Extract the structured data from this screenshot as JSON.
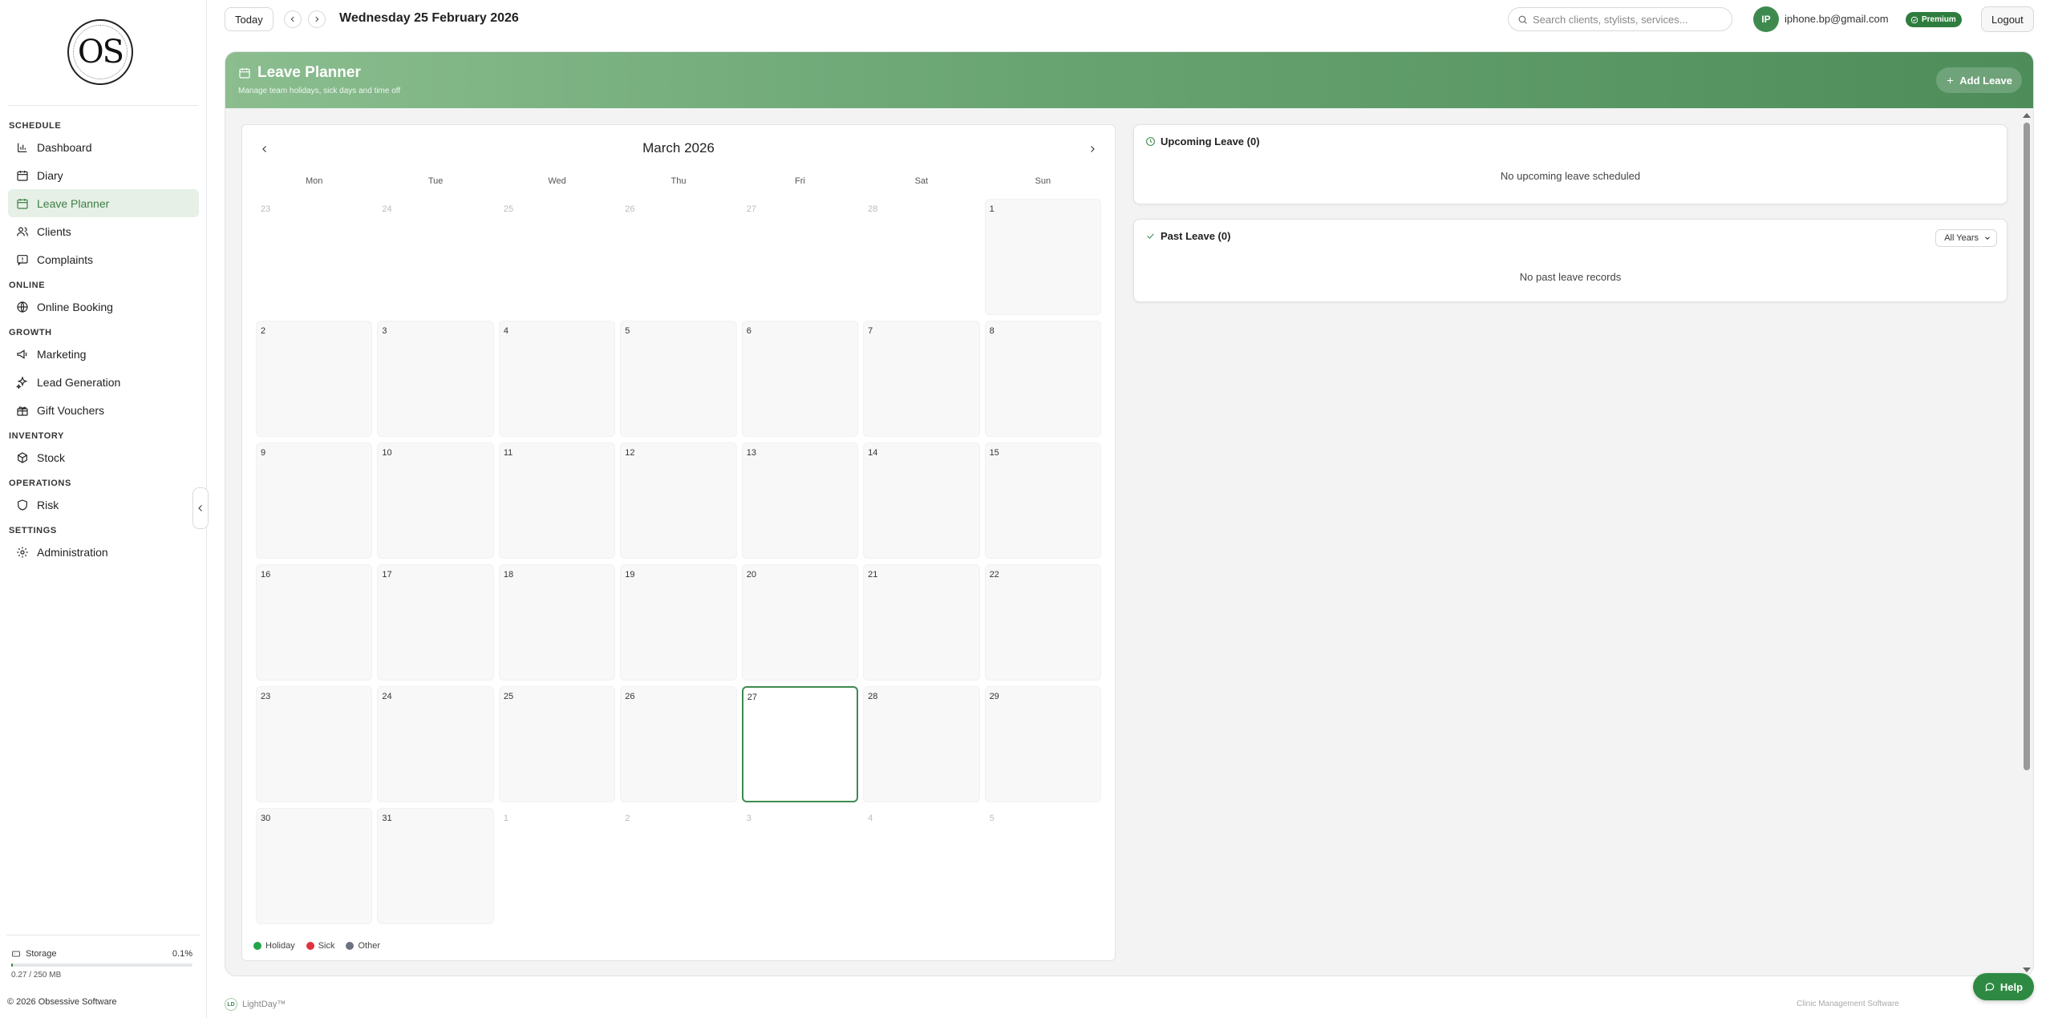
{
  "brand": {
    "logo_text": "OS"
  },
  "sidebar": {
    "sections": [
      {
        "title": "SCHEDULE",
        "items": [
          {
            "label": "Dashboard",
            "icon": "chart-icon",
            "active": false
          },
          {
            "label": "Diary",
            "icon": "calendar-icon",
            "active": false
          },
          {
            "label": "Leave Planner",
            "icon": "calendar-icon",
            "active": true
          },
          {
            "label": "Clients",
            "icon": "users-icon",
            "active": false
          },
          {
            "label": "Complaints",
            "icon": "message-icon",
            "active": false
          }
        ]
      },
      {
        "title": "ONLINE",
        "items": [
          {
            "label": "Online Booking",
            "icon": "globe-icon",
            "active": false
          }
        ]
      },
      {
        "title": "GROWTH",
        "items": [
          {
            "label": "Marketing",
            "icon": "megaphone-icon",
            "active": false
          },
          {
            "label": "Lead Generation",
            "icon": "sparkle-icon",
            "active": false
          },
          {
            "label": "Gift Vouchers",
            "icon": "gift-icon",
            "active": false
          }
        ]
      },
      {
        "title": "INVENTORY",
        "items": [
          {
            "label": "Stock",
            "icon": "package-icon",
            "active": false
          }
        ]
      },
      {
        "title": "OPERATIONS",
        "items": [
          {
            "label": "Risk",
            "icon": "shield-icon",
            "active": false
          }
        ]
      },
      {
        "title": "SETTINGS",
        "items": [
          {
            "label": "Administration",
            "icon": "gear-icon",
            "active": false
          }
        ]
      }
    ],
    "storage": {
      "label": "Storage",
      "percent": "0.1%",
      "fraction": 0.001,
      "detail": "0.27 / 250 MB"
    },
    "copyright": "© 2026 Obsessive Software"
  },
  "topbar": {
    "today_label": "Today",
    "current_date": "Wednesday 25 February 2026",
    "search_placeholder": "Search clients, stylists, services...",
    "avatar_initials": "IP",
    "user_email": "iphone.bp@gmail.com",
    "plan_badge": "Premium",
    "logout_label": "Logout"
  },
  "banner": {
    "title": "Leave Planner",
    "subtitle": "Manage team holidays, sick days and time off",
    "add_button": "Add Leave"
  },
  "calendar": {
    "month_label": "March 2026",
    "weekdays": [
      "Mon",
      "Tue",
      "Wed",
      "Thu",
      "Fri",
      "Sat",
      "Sun"
    ],
    "weeks": [
      [
        {
          "d": "23",
          "out": true
        },
        {
          "d": "24",
          "out": true
        },
        {
          "d": "25",
          "out": true
        },
        {
          "d": "26",
          "out": true
        },
        {
          "d": "27",
          "out": true
        },
        {
          "d": "28",
          "out": true
        },
        {
          "d": "1",
          "out": false
        }
      ],
      [
        {
          "d": "2",
          "out": false
        },
        {
          "d": "3",
          "out": false
        },
        {
          "d": "4",
          "out": false
        },
        {
          "d": "5",
          "out": false
        },
        {
          "d": "6",
          "out": false
        },
        {
          "d": "7",
          "out": false
        },
        {
          "d": "8",
          "out": false
        }
      ],
      [
        {
          "d": "9",
          "out": false
        },
        {
          "d": "10",
          "out": false
        },
        {
          "d": "11",
          "out": false
        },
        {
          "d": "12",
          "out": false
        },
        {
          "d": "13",
          "out": false
        },
        {
          "d": "14",
          "out": false
        },
        {
          "d": "15",
          "out": false
        }
      ],
      [
        {
          "d": "16",
          "out": false
        },
        {
          "d": "17",
          "out": false
        },
        {
          "d": "18",
          "out": false
        },
        {
          "d": "19",
          "out": false
        },
        {
          "d": "20",
          "out": false
        },
        {
          "d": "21",
          "out": false
        },
        {
          "d": "22",
          "out": false
        }
      ],
      [
        {
          "d": "23",
          "out": false
        },
        {
          "d": "24",
          "out": false
        },
        {
          "d": "25",
          "out": false
        },
        {
          "d": "26",
          "out": false
        },
        {
          "d": "27",
          "out": false,
          "today": true
        },
        {
          "d": "28",
          "out": false
        },
        {
          "d": "29",
          "out": false
        }
      ],
      [
        {
          "d": "30",
          "out": false
        },
        {
          "d": "31",
          "out": false
        },
        {
          "d": "1",
          "out": true,
          "empty": true
        },
        {
          "d": "2",
          "out": true,
          "empty": true
        },
        {
          "d": "3",
          "out": true,
          "empty": true
        },
        {
          "d": "4",
          "out": true,
          "empty": true
        },
        {
          "d": "5",
          "out": true,
          "empty": true
        }
      ]
    ],
    "legend": [
      {
        "label": "Holiday",
        "color": "#22a447"
      },
      {
        "label": "Sick",
        "color": "#e0323c"
      },
      {
        "label": "Other",
        "color": "#6b7280"
      }
    ]
  },
  "upcoming": {
    "title": "Upcoming Leave (0)",
    "empty_text": "No upcoming leave scheduled"
  },
  "past": {
    "title": "Past Leave (0)",
    "empty_text": "No past leave records",
    "filter_value": "All Years"
  },
  "footer": {
    "product": "LightDay™",
    "badge": "LD",
    "tagline": "Clinic Management Software"
  },
  "help_label": "Help",
  "colors": {
    "accent": "#3e8a4e",
    "active_bg": "#e6f0e6"
  }
}
